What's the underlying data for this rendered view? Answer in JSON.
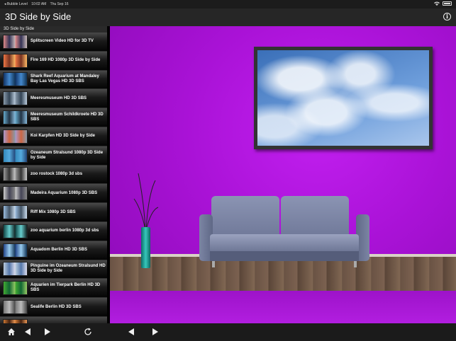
{
  "status_bar": {
    "back_app": "◂ Bubble Level",
    "time": "10:02 AM",
    "date": "Thu Sep 16"
  },
  "nav": {
    "title": "3D Side by Side",
    "info_icon": "info-icon"
  },
  "sidebar": {
    "header": "3D Side by Side",
    "items": [
      {
        "label": "Splitscreen Video HD for 3D TV",
        "thumb": "th-a"
      },
      {
        "label": "Fire 169 HD 1080p 3D Side by Side",
        "thumb": "th-b"
      },
      {
        "label": "Shark Reef Aquarium at Mandaley Bay Las Vegas HD 3D SBS",
        "thumb": "th-c"
      },
      {
        "label": "Meeresmuseum HD 3D SBS",
        "thumb": "th-d"
      },
      {
        "label": "Meeresmuseum Schildkroete HD 3D SBS",
        "thumb": "th-e"
      },
      {
        "label": "Koi Karpfen HD 3D Side by Side",
        "thumb": "th-f"
      },
      {
        "label": "Ozeaneum Stralsund 1080p 3D Side by Side",
        "thumb": "th-g"
      },
      {
        "label": "zoo rostock 1080p 3d sbs",
        "thumb": "th-h"
      },
      {
        "label": "Madeira Aquarium 1080p 3D SBS",
        "thumb": "th-i"
      },
      {
        "label": "Riff Mix 1080p 3D SBS",
        "thumb": "th-j"
      },
      {
        "label": "zoo aquarium berlin 1080p 3d sbs",
        "thumb": "th-k"
      },
      {
        "label": "Aquadom Berlin HD 3D SBS",
        "thumb": "th-l"
      },
      {
        "label": "Pinguine im Ozeaneum Stralsund HD 3D Side by Side",
        "thumb": "th-m"
      },
      {
        "label": "Aquarien im Tierpark Berlin HD 3D SBS",
        "thumb": "th-n"
      },
      {
        "label": "Sealife Berlin HD 3D SBS",
        "thumb": "th-o"
      },
      {
        "label": "",
        "thumb": "th-p"
      }
    ]
  },
  "toolbar": {
    "home_icon": "home-icon",
    "back_icon": "triangle-left-icon",
    "forward_icon": "triangle-right-icon",
    "reload_icon": "reload-icon",
    "preview_back_icon": "triangle-left-icon",
    "preview_forward_icon": "triangle-right-icon"
  },
  "colors": {
    "wall": "#b319e0",
    "nav_bg": "#262626",
    "vase": "#37c8bb"
  }
}
